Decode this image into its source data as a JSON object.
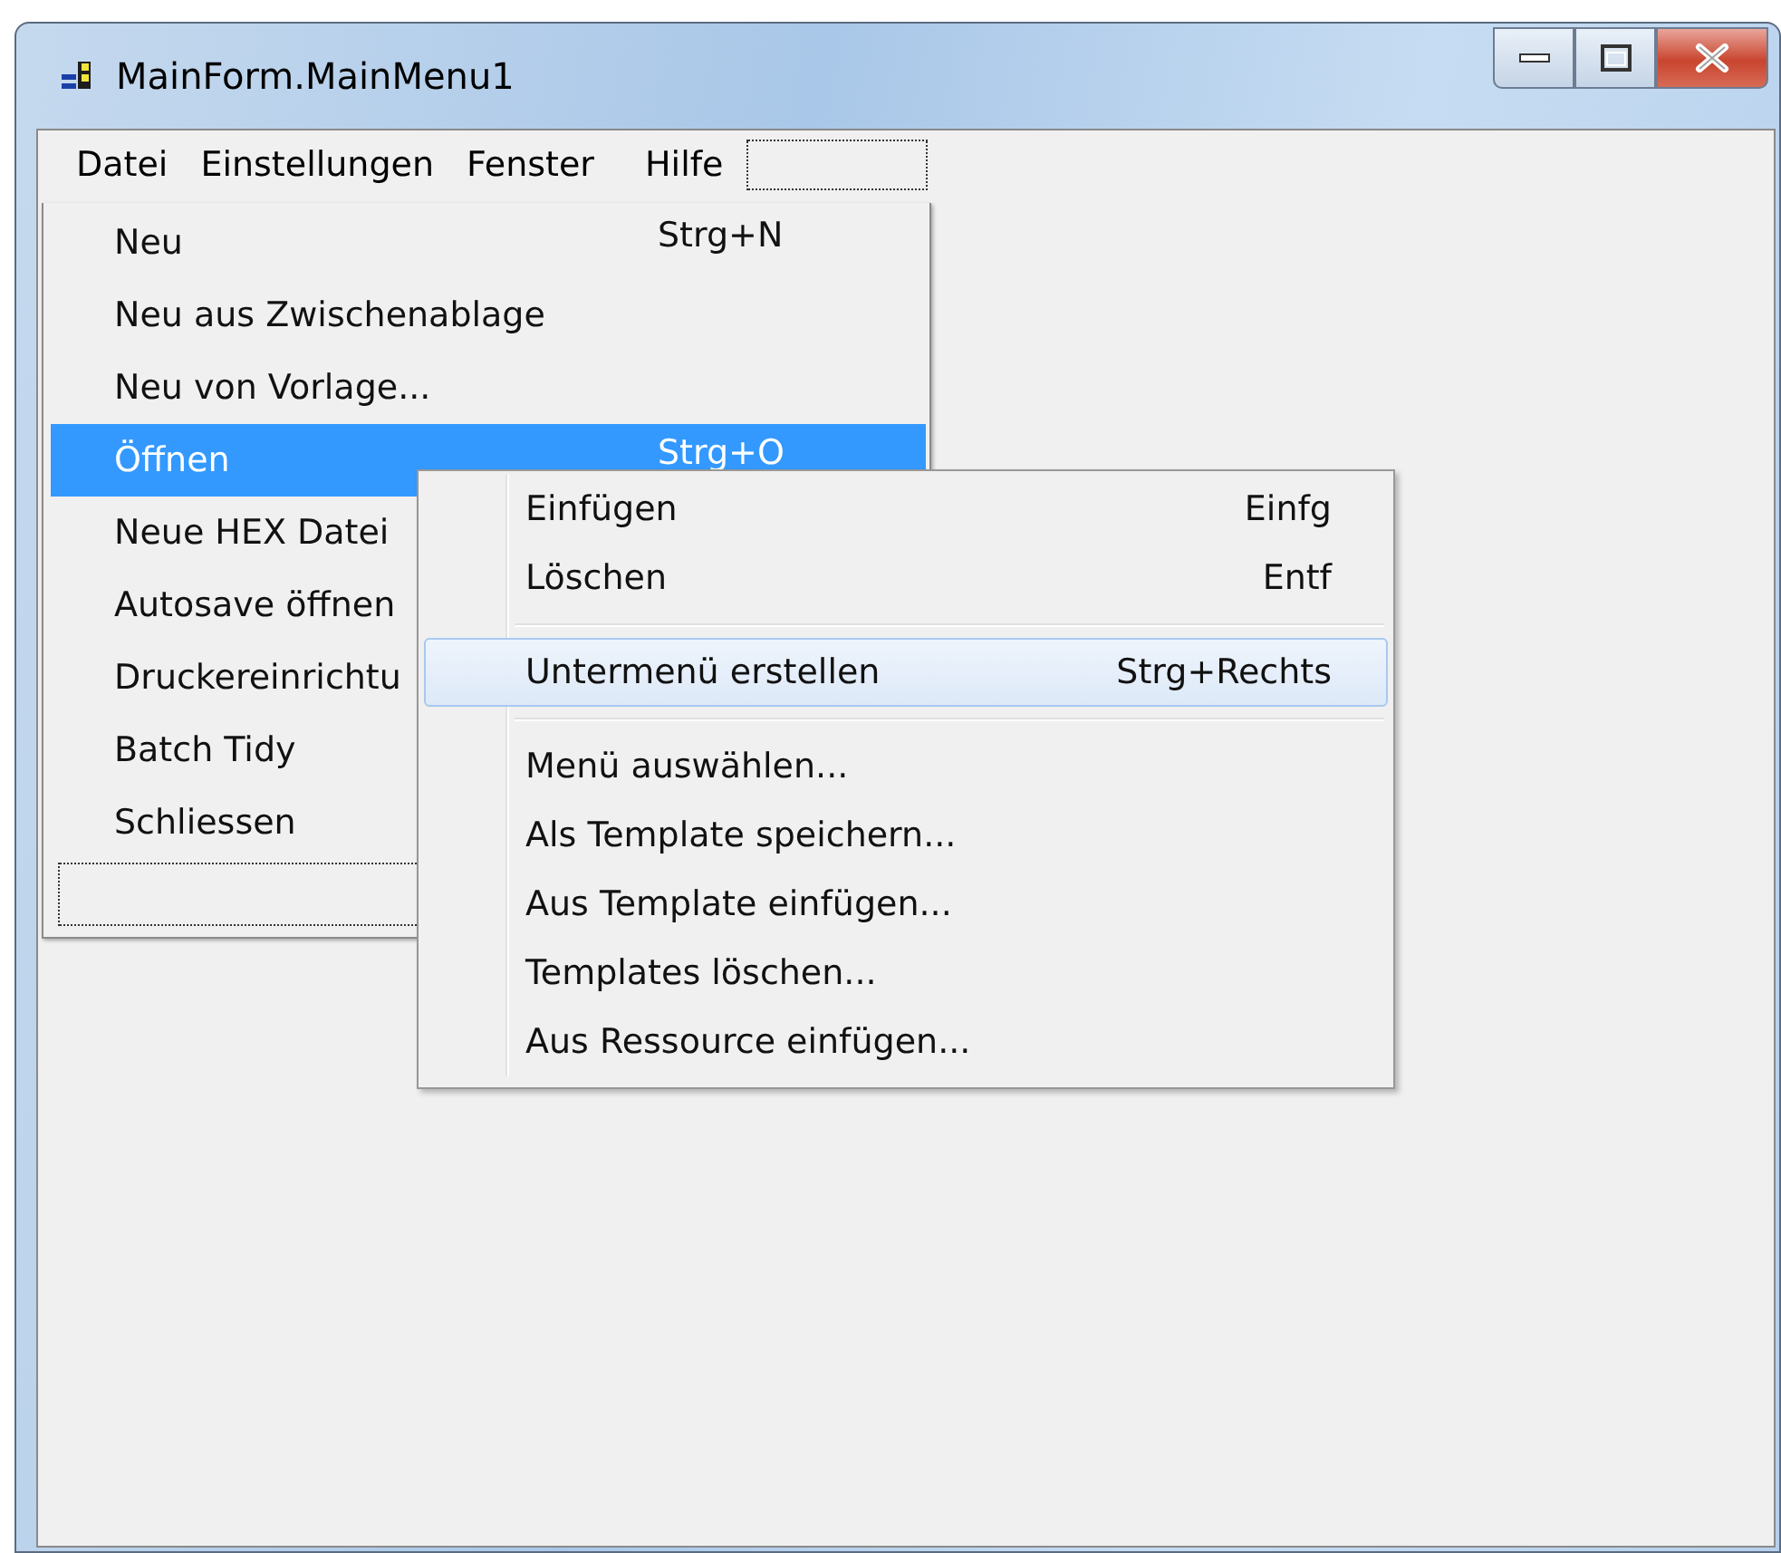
{
  "window": {
    "title": "MainForm.MainMenu1"
  },
  "menubar": [
    {
      "label": "Datei"
    },
    {
      "label": "Einstellungen"
    },
    {
      "label": "Fenster"
    },
    {
      "label": "Hilfe"
    }
  ],
  "dropdown": [
    {
      "label": "Neu",
      "shortcut": "Strg+N",
      "selected": false
    },
    {
      "label": "Neu aus Zwischenablage",
      "selected": false
    },
    {
      "label": "Neu von Vorlage...",
      "selected": false
    },
    {
      "label": "Öffnen",
      "shortcut": "Strg+O",
      "selected": true
    },
    {
      "label": "Neue HEX Datei",
      "selected": false
    },
    {
      "label": "Autosave öffnen",
      "selected": false
    },
    {
      "label": "Druckereinrichtu",
      "selected": false
    },
    {
      "label": "Batch Tidy",
      "selected": false
    },
    {
      "label": "Schliessen",
      "selected": false
    }
  ],
  "context_menu": [
    {
      "kind": "item",
      "label": "Einfügen",
      "shortcut": "Einfg",
      "selected": false
    },
    {
      "kind": "item",
      "label": "Löschen",
      "shortcut": "Entf",
      "selected": false
    },
    {
      "kind": "separator"
    },
    {
      "kind": "item",
      "label": "Untermenü erstellen",
      "shortcut": "Strg+Rechts",
      "selected": true
    },
    {
      "kind": "separator"
    },
    {
      "kind": "item",
      "label": "Menü auswählen...",
      "selected": false
    },
    {
      "kind": "item",
      "label": "Als Template speichern...",
      "selected": false
    },
    {
      "kind": "item",
      "label": "Aus Template einfügen...",
      "selected": false
    },
    {
      "kind": "item",
      "label": "Templates löschen...",
      "selected": false
    },
    {
      "kind": "item",
      "label": "Aus Ressource einfügen...",
      "selected": false
    }
  ]
}
